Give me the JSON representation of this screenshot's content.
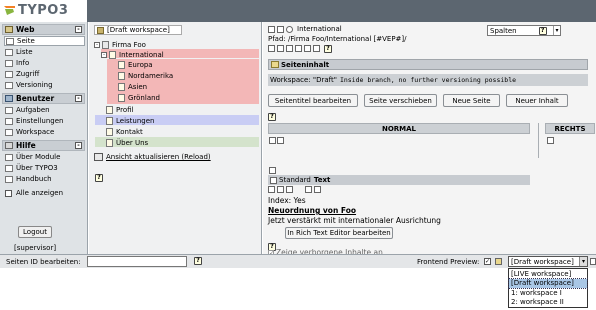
{
  "app": {
    "logo_text": "TYPO3"
  },
  "leftmenu": {
    "groups": [
      {
        "title": "Web",
        "items": [
          "Seite",
          "Liste",
          "Info",
          "Zugriff",
          "Versioning"
        ]
      },
      {
        "title": "Benutzer",
        "items": [
          "Aufgaben",
          "Einstellungen",
          "Workspace"
        ]
      },
      {
        "title": "Hilfe",
        "items": [
          "Über Module",
          "Über TYPO3",
          "Handbuch"
        ]
      }
    ],
    "show_all_label": "Alle anzeigen",
    "logout_label": "Logout",
    "user_label": "[supervisor]"
  },
  "tree": {
    "workspace_tab": "[Draft workspace]",
    "nodes": [
      "Firma Foo",
      "International",
      "Europa",
      "Nordamerika",
      "Asien",
      "Grönland",
      "Profil",
      "Leistungen",
      "Kontakt",
      "Über Uns"
    ],
    "reload_label": "Ansicht aktualisieren (Reload)"
  },
  "content": {
    "page_title": "International",
    "path": "Pfad: /Firma Foo/International [#VEP#]/",
    "view_select": "Spalten",
    "section_title": "Seiteninhalt",
    "ws_note_label": "Workspace: \"Draft\"",
    "ws_note_detail": "Inside branch, no further versioning possible",
    "buttons": [
      "Seitentitel bearbeiten",
      "Seite verschieben",
      "Neue Seite",
      "Neuer Inhalt"
    ],
    "columns": [
      "NORMAL",
      "RECHTS"
    ],
    "element_type": "Standard",
    "element_type_bold": "Text",
    "element_index": "Index: Yes",
    "element_heading": "Neuordnung von Foo",
    "element_body": "Jetzt verstärkt mit internationaler Ausrichtung",
    "rte_button": "In Rich Text Editor bearbeiten",
    "hidden_label": "Zeige verborgene Inhalte an"
  },
  "bottombar": {
    "page_id_label": "Seiten ID bearbeiten:",
    "page_id_value": "",
    "frontend_preview_label": "Frontend Preview:",
    "workspace_selected": "[Draft workspace]",
    "workspace_options": [
      "[LIVE workspace]",
      "[Draft workspace]",
      "1: workspace I",
      "2: workspace II"
    ]
  }
}
